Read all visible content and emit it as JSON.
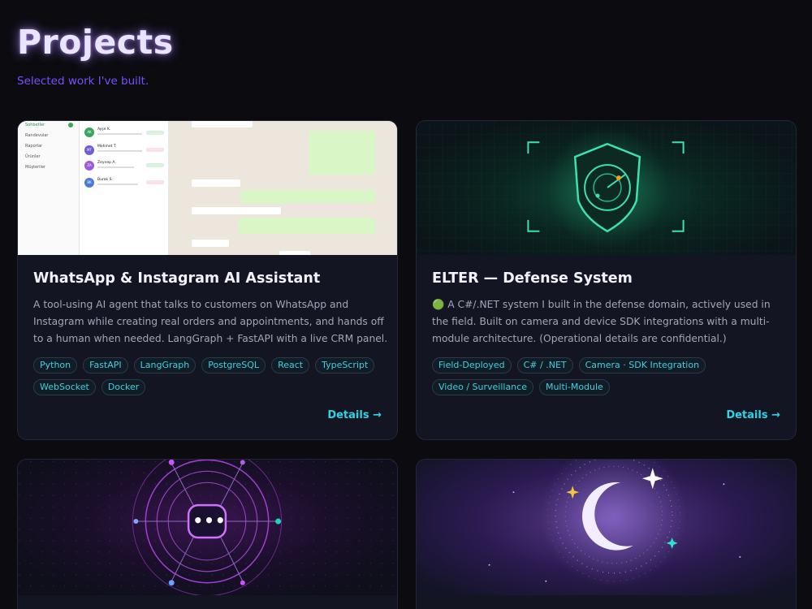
{
  "page": {
    "title": "Projects",
    "subtitle": "Selected work I've built."
  },
  "projects": [
    {
      "title": "WhatsApp & Instagram AI Assistant",
      "description": "A tool-using AI agent that talks to customers on WhatsApp and Instagram while creating real orders and appointments, and hands off to a human when needed. LangGraph + FastAPI with a live CRM panel.",
      "tags": [
        "Python",
        "FastAPI",
        "LangGraph",
        "PostgreSQL",
        "React",
        "TypeScript",
        "WebSocket",
        "Docker"
      ],
      "details_label": "Details →",
      "thumbnail": {
        "sidebar_items": [
          "Sohbetler",
          "Randevular",
          "Raporlar",
          "Ürünler",
          "Müşteriler"
        ],
        "contacts": [
          {
            "initials": "AK",
            "name": "Ayşe K.",
            "color": "#3aa55c"
          },
          {
            "initials": "MT",
            "name": "Mehmet T.",
            "color": "#6d5cd6"
          },
          {
            "initials": "ZA",
            "name": "Zeynep A.",
            "color": "#9c5cd6"
          },
          {
            "initials": "BK",
            "name": "Burak S.",
            "color": "#4a7ad6"
          }
        ]
      }
    },
    {
      "title": "ELTER — Defense System",
      "description": "🟢 A C#/.NET system I built in the defense domain, actively used in the field. Built on camera and device SDK integrations with a multi-module architecture. (Operational details are confidential.)",
      "tags": [
        "Field-Deployed",
        "C# / .NET",
        "Camera · SDK Integration",
        "Video / Surveillance",
        "Multi-Module"
      ],
      "details_label": "Details →"
    },
    {
      "title": "",
      "thumbnail": {
        "center_glyph": "•••"
      }
    },
    {
      "title": ""
    }
  ],
  "colors": {
    "background": "#0b0b10",
    "card": "#131522",
    "accent_cyan": "#2fd3e6",
    "accent_purple": "#7c4dff"
  },
  "icons": [
    "shield-radar-icon",
    "crescent-moon-icon",
    "sparkle-star-icon",
    "chat-dots-icon"
  ]
}
